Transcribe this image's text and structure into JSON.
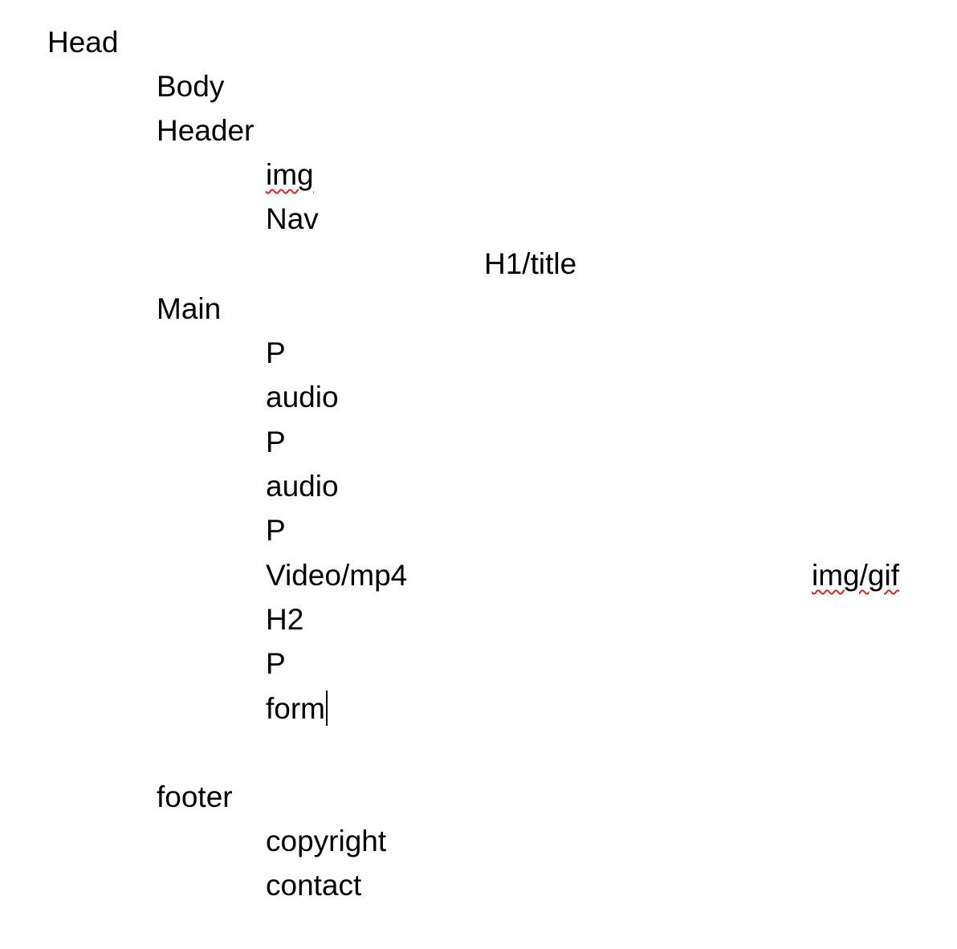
{
  "outline": {
    "head": "Head",
    "body": "Body",
    "header": "Header",
    "header_img": "img",
    "header_nav": "Nav",
    "header_title": "H1/title",
    "main": "Main",
    "main_p1": "P",
    "main_audio1": "audio",
    "main_p2": "P",
    "main_audio2": "audio",
    "main_p3": "P",
    "main_video": "Video/mp4",
    "main_gif": "img/gif",
    "main_h2": "H2",
    "main_p4": "P",
    "main_form": "form",
    "footer": "footer",
    "footer_copyright": "copyright",
    "footer_contact": "contact"
  },
  "colors": {
    "text": "#000000",
    "spellcheck_underline": "#e0261b",
    "background": "#ffffff"
  }
}
